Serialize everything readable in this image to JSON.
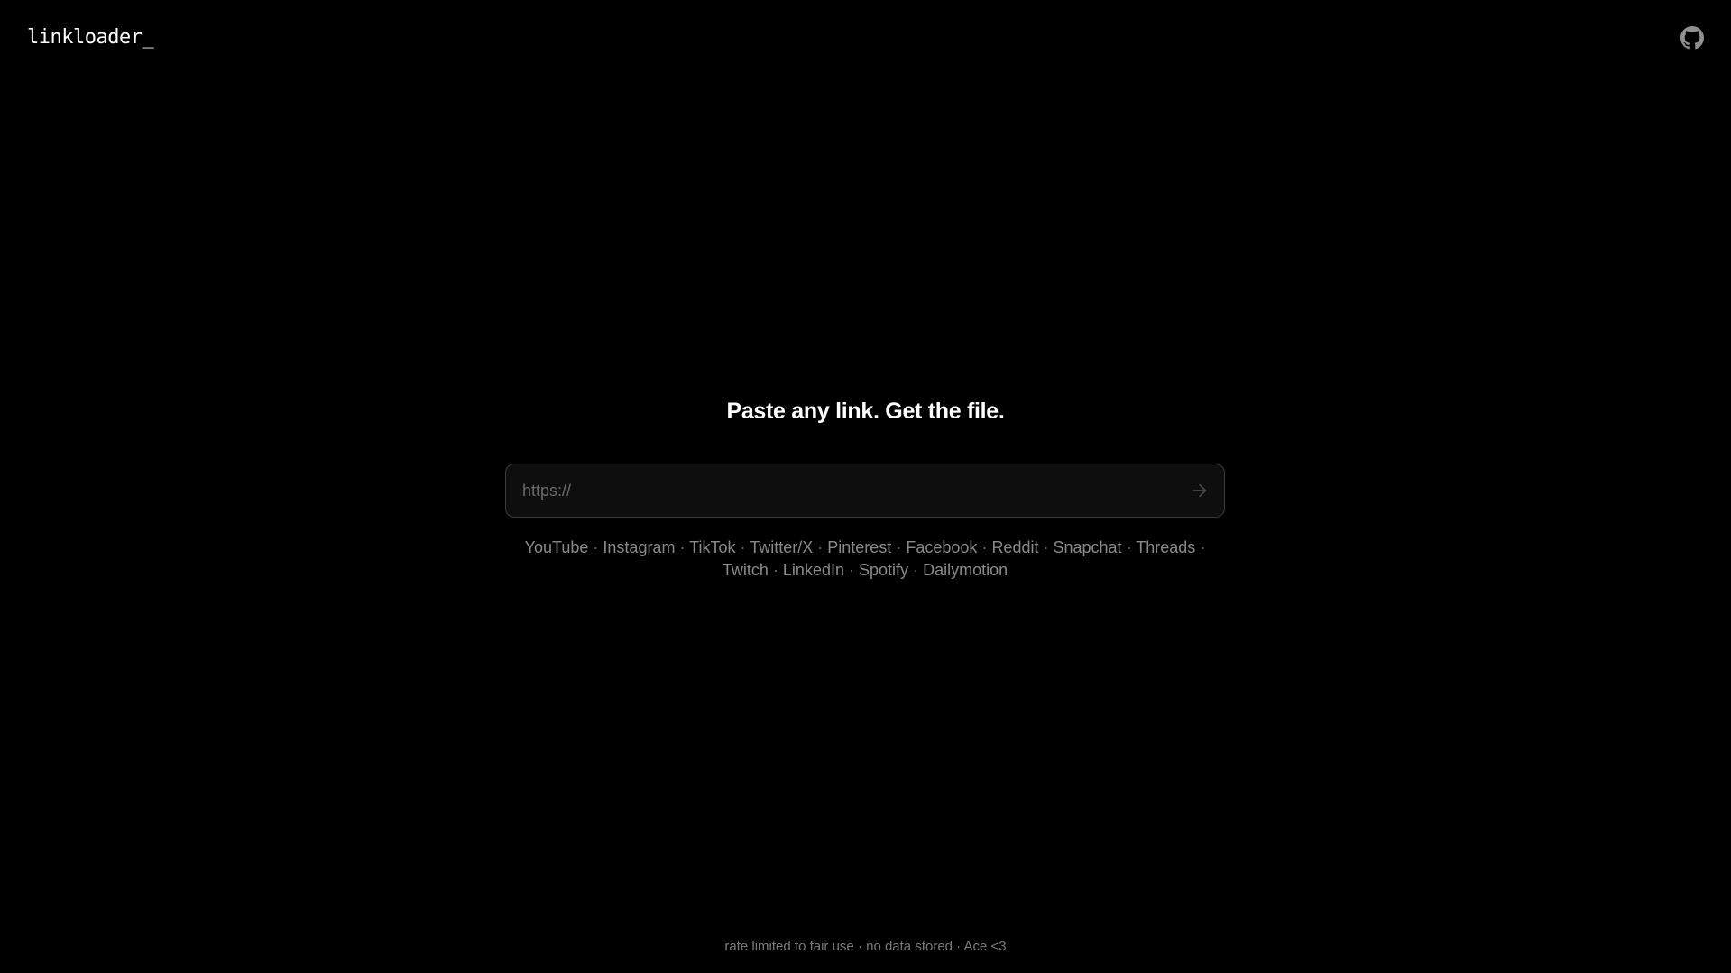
{
  "header": {
    "logo": "linkloader_",
    "github_icon": "github-icon"
  },
  "hero": {
    "headline": "Paste any link. Get the file."
  },
  "url_input": {
    "placeholder": "https://",
    "value": "",
    "submit_icon": "arrow-right-icon"
  },
  "platforms": [
    "YouTube",
    "Instagram",
    "TikTok",
    "Twitter/X",
    "Pinterest",
    "Facebook",
    "Reddit",
    "Snapchat",
    "Threads",
    "Twitch",
    "LinkedIn",
    "Spotify",
    "Dailymotion"
  ],
  "platform_separator": "·",
  "footer": {
    "text": "rate limited to fair use · no data stored · Ace <3"
  },
  "colors": {
    "background": "#000000",
    "text_primary": "#ffffff",
    "text_muted": "#8a8a8a",
    "input_border": "#3a3a3a",
    "input_bg": "#0e0e0e"
  }
}
